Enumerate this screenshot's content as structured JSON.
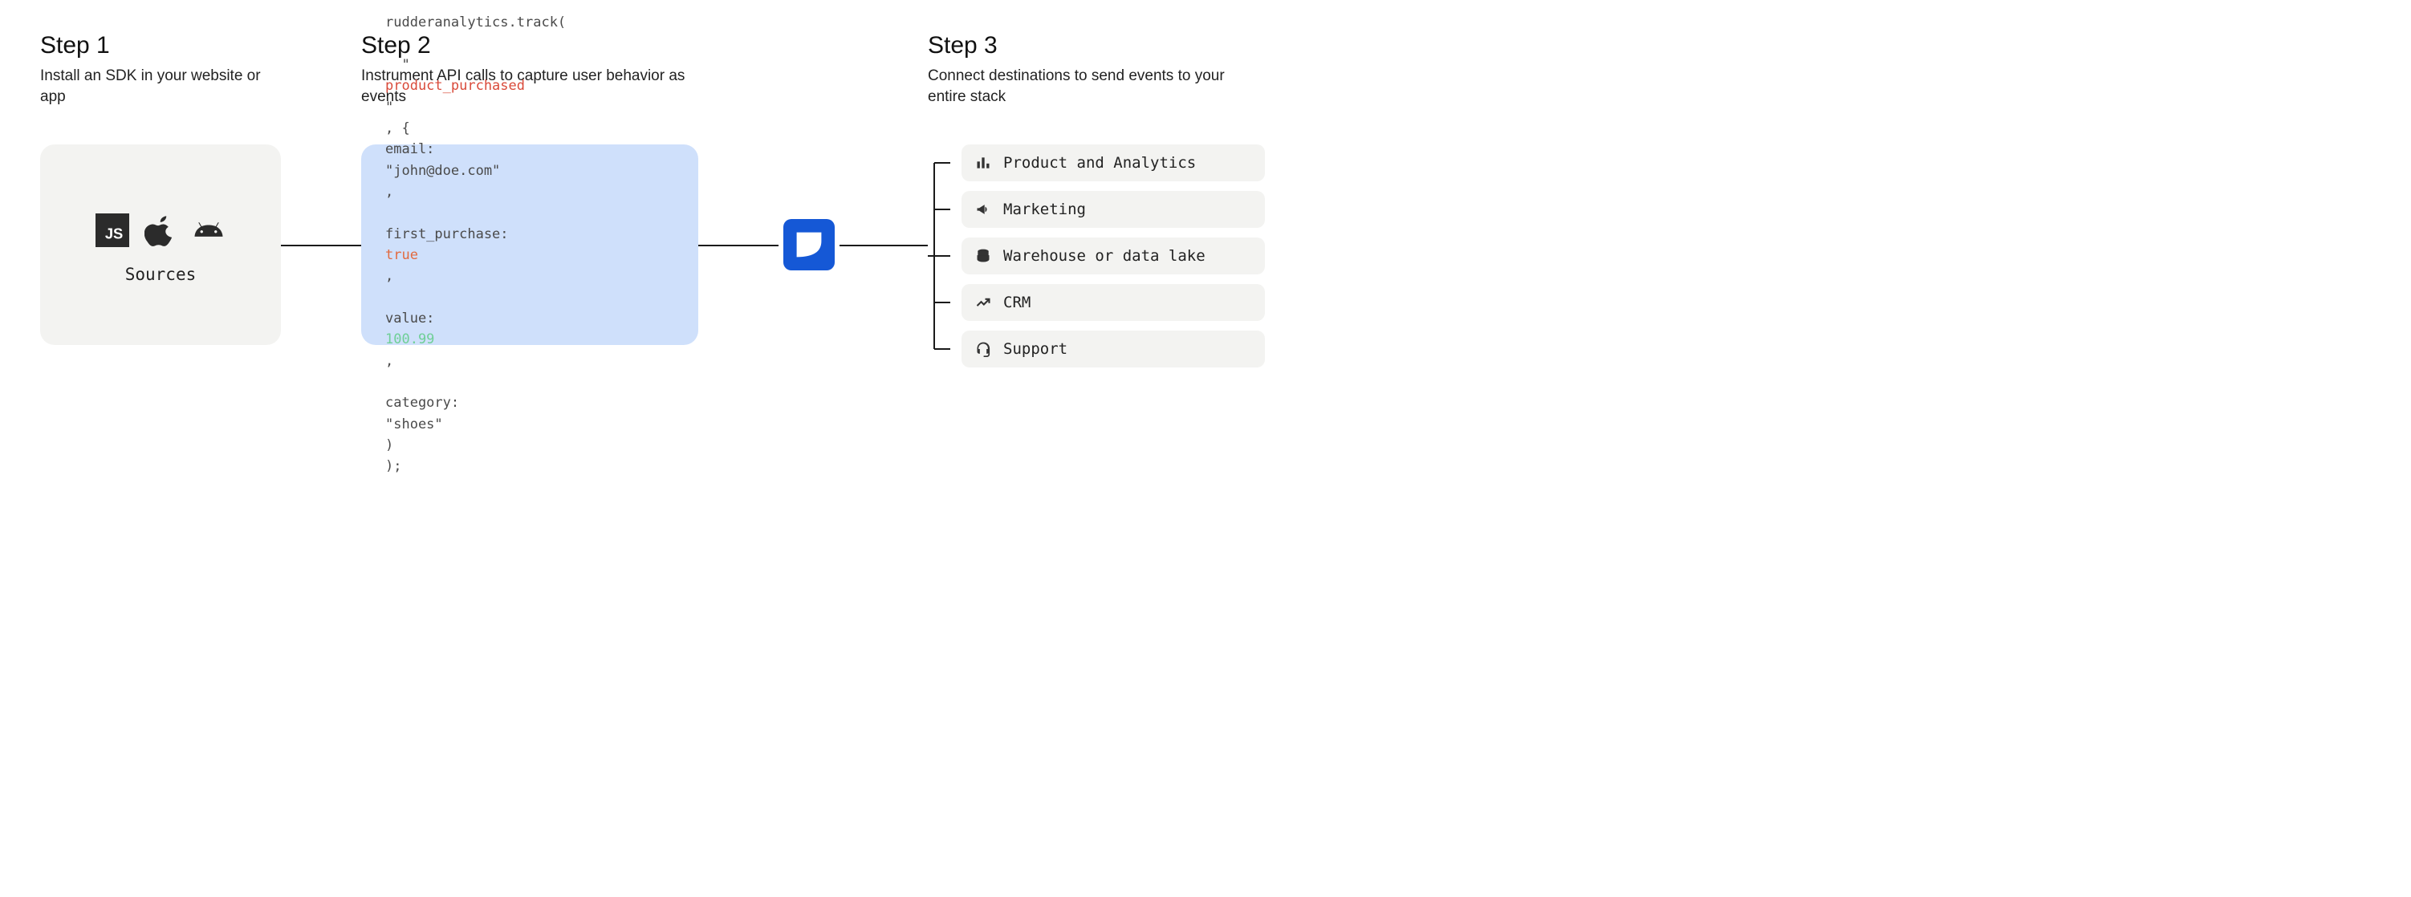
{
  "step1": {
    "title": "Step 1",
    "desc": "Install an SDK in your website or app",
    "sources_label": "Sources",
    "icons": [
      "javascript",
      "apple",
      "android"
    ]
  },
  "step2": {
    "title": "Step 2",
    "desc": "Instrument API calls to capture user behavior as events",
    "code": {
      "line1": "rudderanalytics.track(",
      "string_arg": "product_purchased",
      "obj_open": ", {",
      "email_key": "email:",
      "email_val": "\"john@doe.com\"",
      "first_key": "first_purchase:",
      "first_val": "true",
      "value_key": "value:",
      "value_val": "100.99",
      "cat_key": "category:",
      "cat_val": "\"shoes\"",
      "obj_close": ")",
      "call_close": ");"
    }
  },
  "step3": {
    "title": "Step 3",
    "desc": "Connect destinations to send events to your entire stack",
    "destinations": [
      {
        "icon": "chart",
        "label": "Product and Analytics"
      },
      {
        "icon": "megaphone",
        "label": "Marketing"
      },
      {
        "icon": "database",
        "label": "Warehouse or data lake"
      },
      {
        "icon": "trend",
        "label": "CRM"
      },
      {
        "icon": "headset",
        "label": "Support"
      }
    ]
  }
}
